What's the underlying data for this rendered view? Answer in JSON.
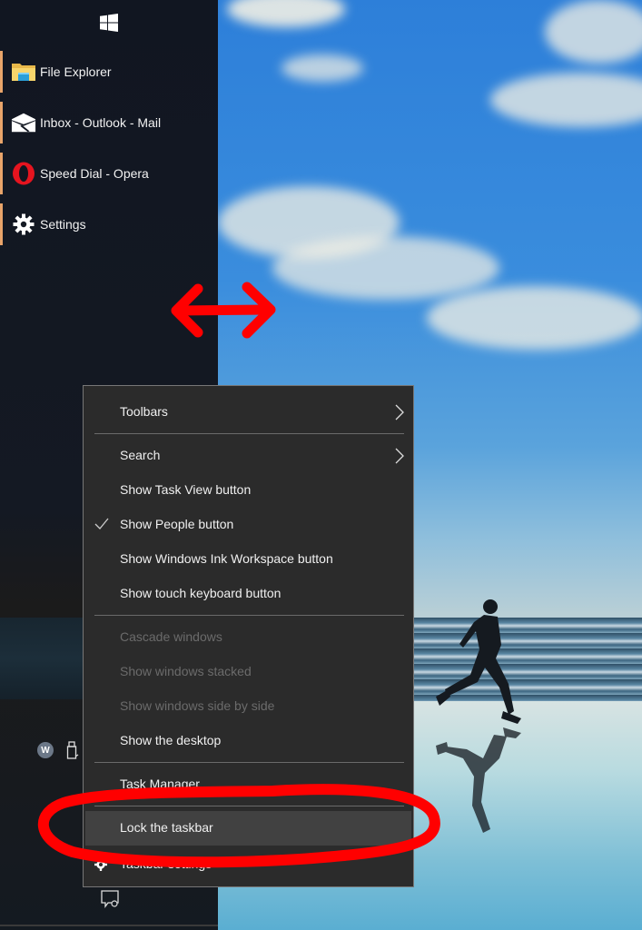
{
  "taskbar": {
    "start_icon": "windows-logo-icon",
    "items": [
      {
        "label": "File Explorer",
        "icon": "folder-icon"
      },
      {
        "label": "Inbox - Outlook - Mail",
        "icon": "mail-icon"
      },
      {
        "label": "Speed Dial - Opera",
        "icon": "opera-icon"
      },
      {
        "label": "Settings",
        "icon": "gear-icon"
      }
    ],
    "accent_color": "#e8a46a",
    "tray": {
      "w_badge": "W",
      "usb_icon": "usb-drive-icon",
      "notification_icon": "action-center-icon"
    }
  },
  "context_menu": {
    "items": [
      {
        "label": "Toolbars",
        "submenu": true,
        "enabled": true
      },
      {
        "label": "Search",
        "submenu": true,
        "enabled": true
      },
      {
        "label": "Show Task View button",
        "enabled": true
      },
      {
        "label": "Show People button",
        "enabled": true,
        "checked": true
      },
      {
        "label": "Show Windows Ink Workspace button",
        "enabled": true
      },
      {
        "label": "Show touch keyboard button",
        "enabled": true
      },
      {
        "label": "Cascade windows",
        "enabled": false
      },
      {
        "label": "Show windows stacked",
        "enabled": false
      },
      {
        "label": "Show windows side by side",
        "enabled": false
      },
      {
        "label": "Show the desktop",
        "enabled": true
      },
      {
        "label": "Task Manager",
        "enabled": true
      },
      {
        "label": "Lock the taskbar",
        "enabled": true,
        "highlighted": true
      },
      {
        "label": "Taskbar settings",
        "enabled": true,
        "icon": "gear-icon"
      }
    ]
  },
  "annotations": {
    "color": "#ff0000",
    "arrow": "double-headed-arrow",
    "circle_target": "Lock the taskbar"
  }
}
